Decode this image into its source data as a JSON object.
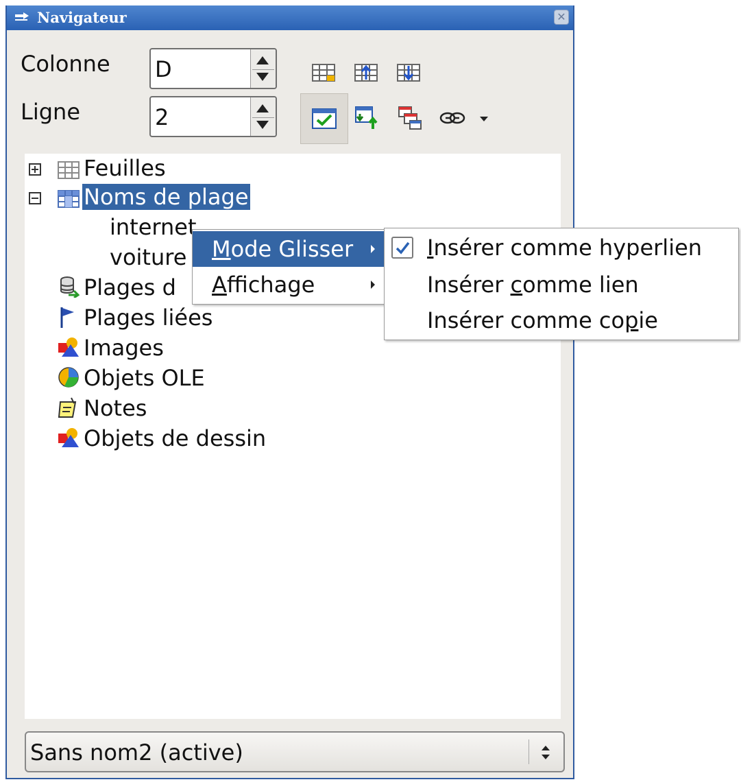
{
  "window": {
    "title": "Navigateur"
  },
  "navigation": {
    "column_label": "Colonne",
    "column_value": "D",
    "row_label": "Ligne",
    "row_value": "2"
  },
  "toolbar": {
    "row1": [
      "data-range-icon",
      "start-icon",
      "end-icon"
    ],
    "row2": [
      "contents-icon",
      "toggle-icon",
      "scenarios-icon",
      "drag-mode-icon",
      "dropdown-arrow-icon"
    ]
  },
  "tree": {
    "sheets": "Feuilles",
    "range_names": "Noms de plage",
    "range_children": [
      "internet",
      "voiture"
    ],
    "database_ranges": "Plages d",
    "linked_ranges": "Plages liées",
    "images": "Images",
    "ole_objects": "Objets OLE",
    "notes": "Notes",
    "drawing_objects": "Objets de dessin"
  },
  "document_select": {
    "value": "Sans nom2 (active)"
  },
  "context_menu": {
    "items": [
      {
        "first": "M",
        "rest": "ode Glisser"
      },
      {
        "first": "A",
        "rest": "ffichage"
      }
    ]
  },
  "drag_mode_menu": {
    "items": [
      {
        "pre": "",
        "u": "I",
        "post": "nsérer comme hyperlien",
        "checked": true
      },
      {
        "pre": "Insérer ",
        "u": "c",
        "post": "omme lien",
        "checked": false
      },
      {
        "pre": "Insérer comme co",
        "u": "p",
        "post": "ie",
        "checked": false
      }
    ]
  },
  "colors": {
    "title_bar": "#2a62b4",
    "selection": "#3465a4",
    "window_bg": "#edebe7"
  }
}
